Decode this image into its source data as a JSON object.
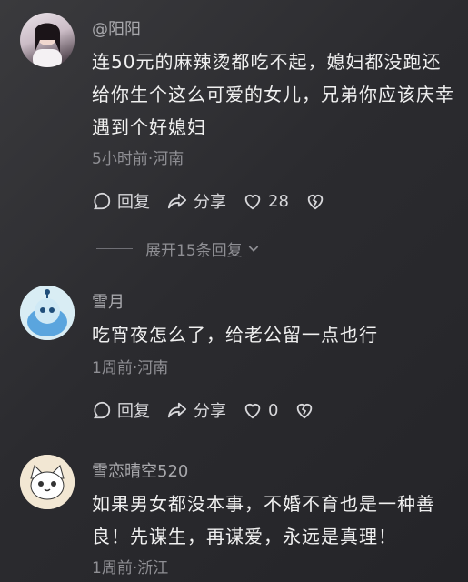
{
  "comments": [
    {
      "username": "@阳阳",
      "text": "连50元的麻辣烫都吃不起，媳妇都没跑还给你生个这么可爱的女儿，兄弟你应该庆幸遇到个好媳妇",
      "meta": "5小时前·河南",
      "reply_label": "回复",
      "share_label": "分享",
      "likes": "28"
    },
    {
      "username": "雪月",
      "text": "吃宵夜怎么了，给老公留一点也行",
      "meta": "1周前·河南",
      "reply_label": "回复",
      "share_label": "分享",
      "likes": "0"
    },
    {
      "username": "雪恋晴空520",
      "text": "如果男女都没本事，不婚不育也是一种善良！先谋生，再谋爱，永远是真理！",
      "meta": "1周前·浙江"
    }
  ],
  "expand_replies": "展开15条回复",
  "colors": {
    "background": "#2b2b2f",
    "text_primary": "#f0f0f0",
    "text_secondary": "#8f8f94"
  }
}
